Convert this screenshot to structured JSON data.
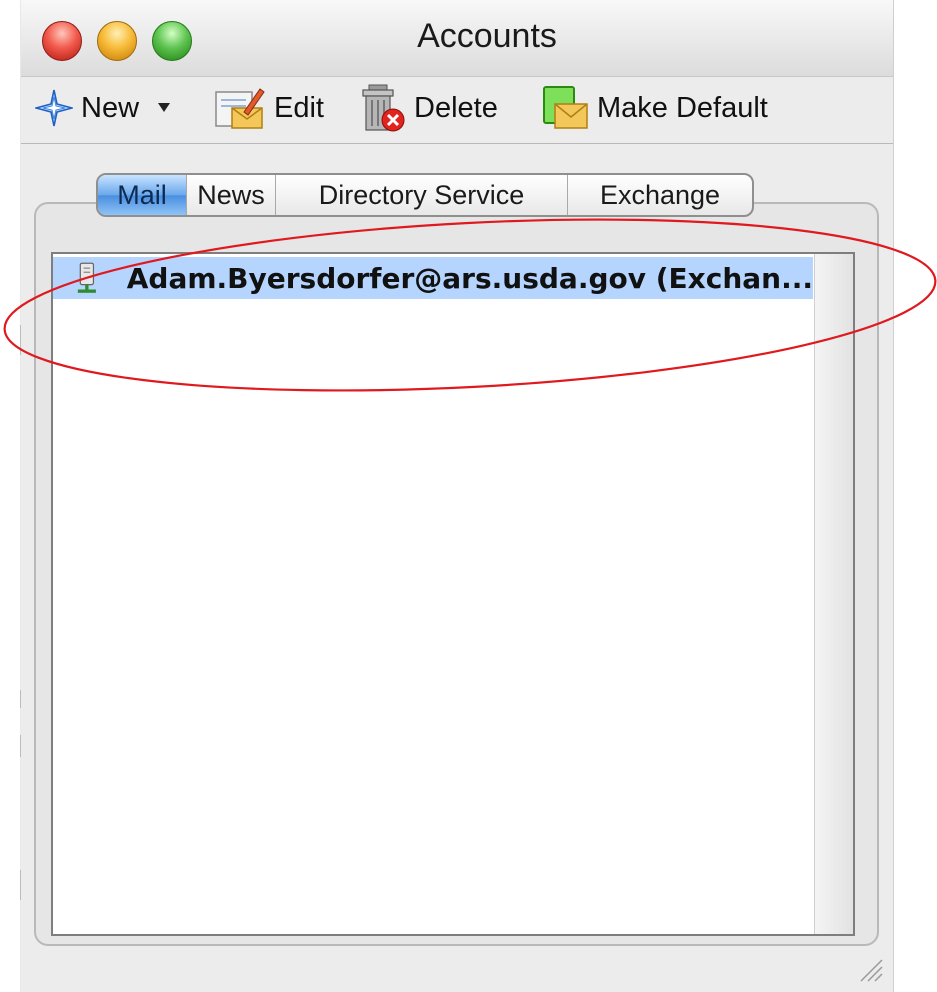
{
  "window": {
    "title": "Accounts",
    "traffic_lights": [
      "close",
      "minimize",
      "zoom"
    ]
  },
  "toolbar": {
    "new_label": "New",
    "edit_label": "Edit",
    "delete_label": "Delete",
    "make_default_label": "Make Default"
  },
  "tabs": [
    {
      "label": "Mail",
      "selected": true
    },
    {
      "label": "News",
      "selected": false
    },
    {
      "label": "Directory Service",
      "selected": false
    },
    {
      "label": "Exchange",
      "selected": false
    }
  ],
  "accounts": [
    {
      "label": "Adam.Byersdorfer@ars.usda.gov (Exchan...",
      "icon": "server-icon",
      "selected": true
    }
  ],
  "colors": {
    "selection": "#b5d5ff",
    "tab_selected": "#6aa8ec",
    "annotation": "#e0191e"
  }
}
